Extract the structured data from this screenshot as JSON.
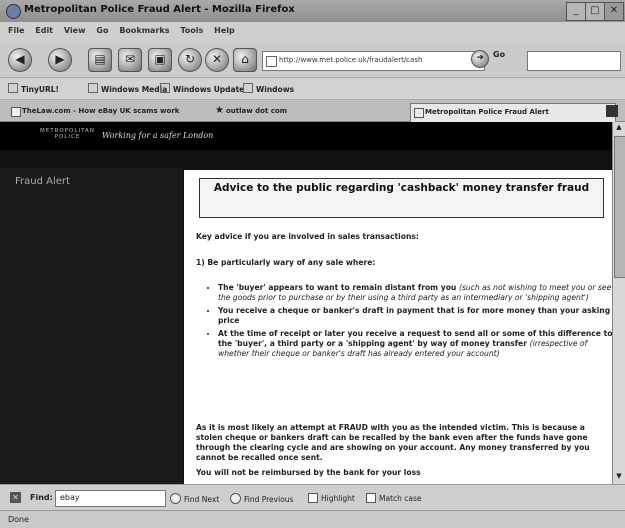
{
  "window": {
    "title": "Metropolitan Police Fraud Alert - Mozilla Firefox"
  },
  "menu": [
    "File",
    "Edit",
    "View",
    "Go",
    "Bookmarks",
    "Tools",
    "Help"
  ],
  "nav": {
    "url": "http://www.met.police.uk/fraudalert/cash",
    "go_label": "Go"
  },
  "bookmarks": [
    "TinyURL!",
    "Windows Media",
    "Windows Update",
    "Windows"
  ],
  "tabs": [
    {
      "label": "TheLaw.com - How eBay UK scams work"
    },
    {
      "label": "outlaw dot com"
    },
    {
      "label": "Metropolitan Police Fraud Alert"
    }
  ],
  "site": {
    "logo_line1": "METROPOLITAN",
    "logo_line2": "POLICE",
    "tagline": "Working for a safer London"
  },
  "sidebar": {
    "title": "Fraud Alert"
  },
  "content": {
    "heading": "Advice to the public regarding 'cashback' money transfer fraud",
    "intro": "Key advice if you are involved in sales transactions:",
    "point1": "1) Be particularly wary of any sale where:",
    "bullets": [
      {
        "main": "The 'buyer' appears to want to remain distant from you",
        "note": "(such as not wishing to meet you or see the goods prior to purchase or by their using a third party as an intermediary or 'shipping agent')"
      },
      {
        "main": "You receive a cheque or banker's draft in payment that is for more money than your asking price",
        "note": ""
      },
      {
        "main": "At the time of receipt or later you receive a request to send all or some of this difference to the 'buyer', a third party or a 'shipping agent' by way of money transfer",
        "note": "(irrespective of whether their cheque or banker's draft has already entered your account)"
      }
    ],
    "fraud_para": "As it is most likely an attempt at FRAUD with you as the intended victim. This is because a stolen cheque or bankers draft can be recalled by the bank even after the funds have gone through the clearing cycle and are showing on your account. Any money transferred by you cannot be recalled once sent.",
    "last_line": "You will not be reimbursed by the bank for your loss"
  },
  "find": {
    "label": "Find:",
    "value": "ebay",
    "next": "Find Next",
    "previous": "Find Previous",
    "highlight": "Highlight",
    "match_case": "Match case"
  },
  "status": "Done"
}
